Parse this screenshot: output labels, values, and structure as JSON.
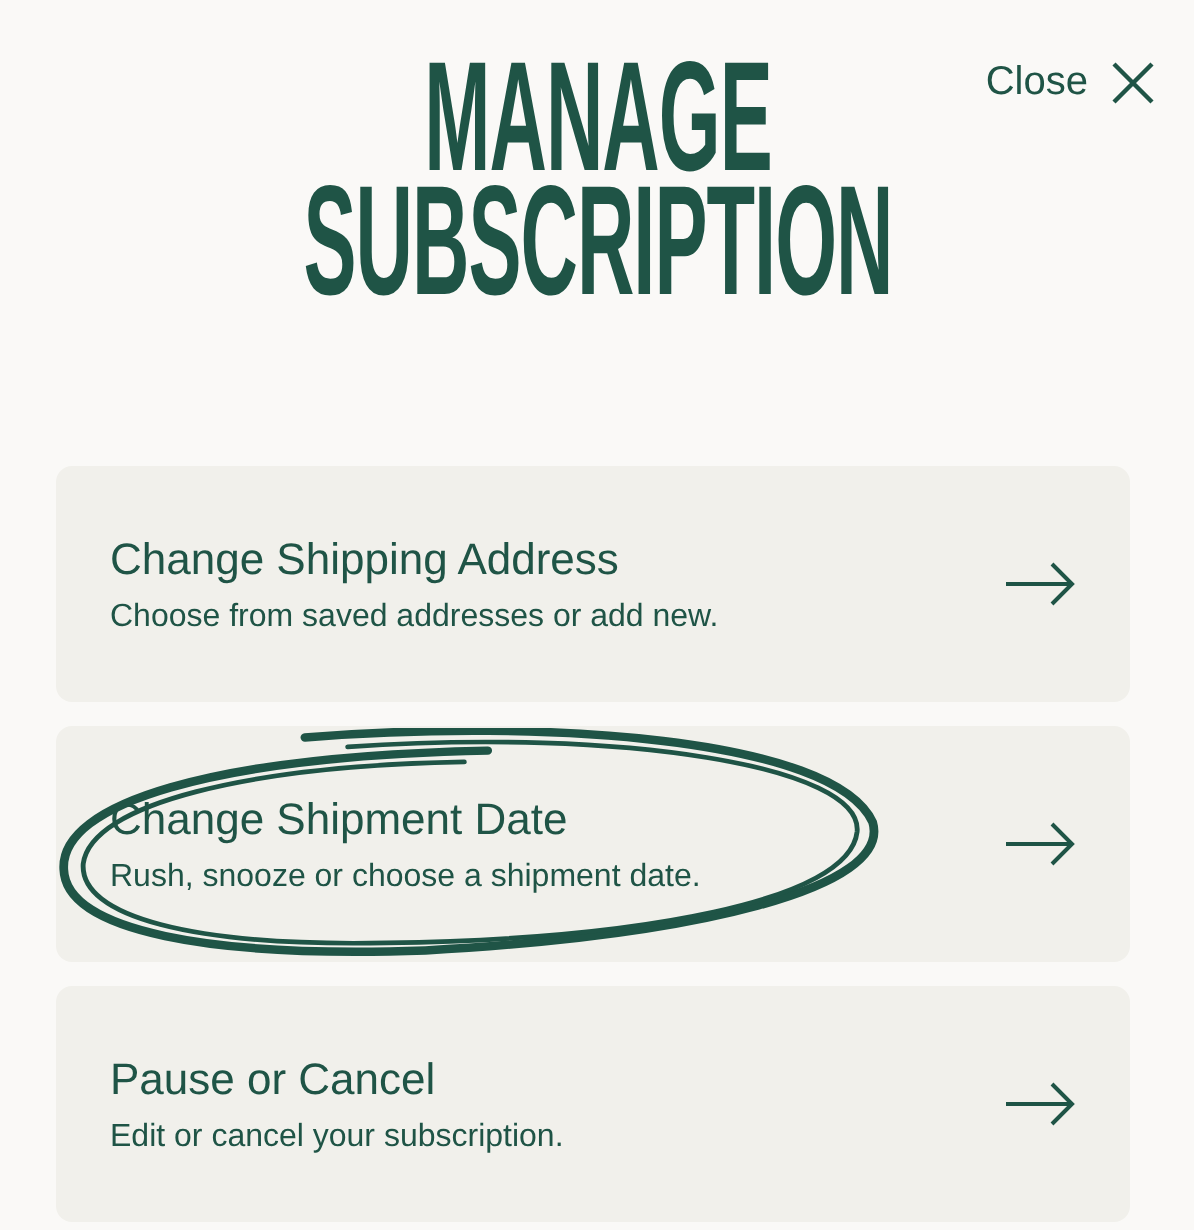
{
  "close": {
    "label": "Close"
  },
  "title": "MANAGE SUBSCRIPTION",
  "options": [
    {
      "title": "Change Shipping Address",
      "description": "Choose from saved addresses or add new.",
      "highlighted": false
    },
    {
      "title": "Change Shipment Date",
      "description": "Rush, snooze or choose a shipment date.",
      "highlighted": true
    },
    {
      "title": "Pause or Cancel",
      "description": "Edit or cancel your subscription.",
      "highlighted": false
    }
  ]
}
